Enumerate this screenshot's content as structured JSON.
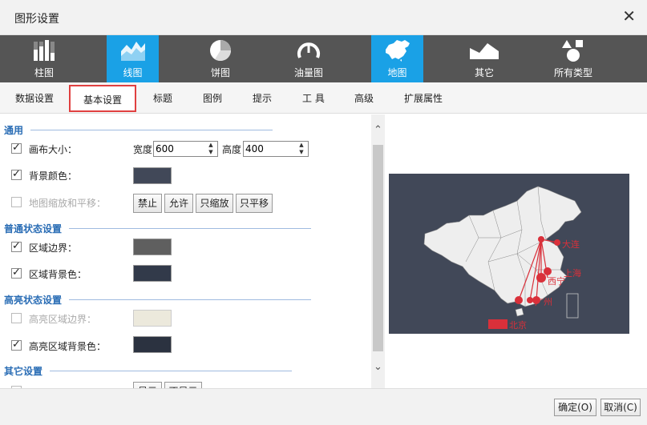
{
  "window": {
    "title": "图形设置",
    "close_glyph": "✕"
  },
  "chart_types": [
    {
      "label": "柱图",
      "icon": "bar-chart-icon",
      "active": false
    },
    {
      "label": "线图",
      "icon": "line-chart-icon",
      "active": true
    },
    {
      "label": "饼图",
      "icon": "pie-chart-icon",
      "active": false
    },
    {
      "label": "油量图",
      "icon": "gauge-icon",
      "active": false
    },
    {
      "label": "地图",
      "icon": "map-icon",
      "active": true
    },
    {
      "label": "其它",
      "icon": "area-chart-icon",
      "active": false
    },
    {
      "label": "所有类型",
      "icon": "shapes-icon",
      "active": false
    }
  ],
  "tabs": [
    "数据设置",
    "基本设置",
    "标题",
    "图例",
    "提示",
    "工 具",
    "高级",
    "扩展属性"
  ],
  "active_tab": "基本设置",
  "sections": {
    "general": "通用",
    "normal": "普通状态设置",
    "highlight": "高亮状态设置",
    "other": "其它设置"
  },
  "general": {
    "canvas_size_label": "画布大小：",
    "width_label": "宽度",
    "width_value": "600",
    "height_label": "高度",
    "height_value": "400",
    "bg_color_label": "背景颜色：",
    "bg_color": "#414858",
    "zoom_pan_label": "地图缩放和平移：",
    "zoom_pan_buttons": [
      "禁止",
      "允许",
      "只缩放",
      "只平移"
    ]
  },
  "normal": {
    "border_label": "区域边界：",
    "border_color": "#5f5f5f",
    "area_bg_label": "区域背景色：",
    "area_bg_color": "#323a4a"
  },
  "highlight": {
    "border_label": "高亮区域边界：",
    "border_color": "#ece9dc",
    "area_bg_label": "高亮区域背景色：",
    "area_bg_color": "#2b3240"
  },
  "other": {
    "buttons": [
      "显示",
      "不显示"
    ]
  },
  "preview": {
    "bg_color": "#414858",
    "land_color": "#eeeeee",
    "route_color": "#d9303a",
    "city_labels": [
      "大连",
      "上海",
      "西宁",
      "广州"
    ],
    "legend_label": "北京"
  },
  "footer": {
    "ok_label": "确定(O)",
    "cancel_label": "取消(C)"
  }
}
